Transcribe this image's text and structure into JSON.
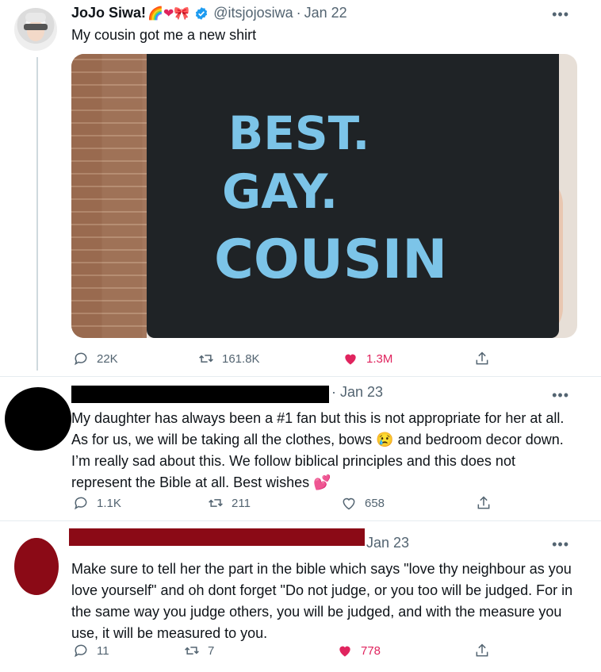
{
  "main_tweet": {
    "name": "JoJo Siwa!",
    "emojis": "🌈❤🎀",
    "handle": "@itsjojosiwa",
    "separator": "·",
    "date": "Jan 22",
    "more": "•••",
    "text": "My cousin got me a new shirt",
    "shirt_text": [
      "BEST.",
      "GAY.",
      "COUSIN"
    ],
    "replies": "22K",
    "retweets": "161.8K",
    "likes": "1.3M",
    "liked": true
  },
  "reply_1": {
    "separator_date": "· Jan 23",
    "more": "•••",
    "text": "My daughter has always been a #1 fan but this is not appropriate for her at all. As for us, we will be taking all the clothes, bows 😢 and bedroom decor down. I’m really sad about this. We follow biblical principles and this does not represent the Bible at all. Best wishes 💕",
    "replies": "1.1K",
    "retweets": "211",
    "likes": "658",
    "liked": false
  },
  "reply_2": {
    "date": "Jan 23",
    "more": "•••",
    "text": "Make sure to tell her the part in the bible which says \"love thy neighbour as you love yourself\" and oh dont forget \"Do not judge, or you too will be judged. For in the same way you judge others, you will be judged, and with the measure you use, it will be measured to you.",
    "replies": "11",
    "retweets": "7",
    "likes": "778",
    "liked": true
  },
  "colors": {
    "like_active": "#e0245e",
    "verified": "#1d9bf0",
    "muted": "#536471",
    "shirt_text": "#7cc4e8",
    "redaction_red": "#8b0a16"
  }
}
